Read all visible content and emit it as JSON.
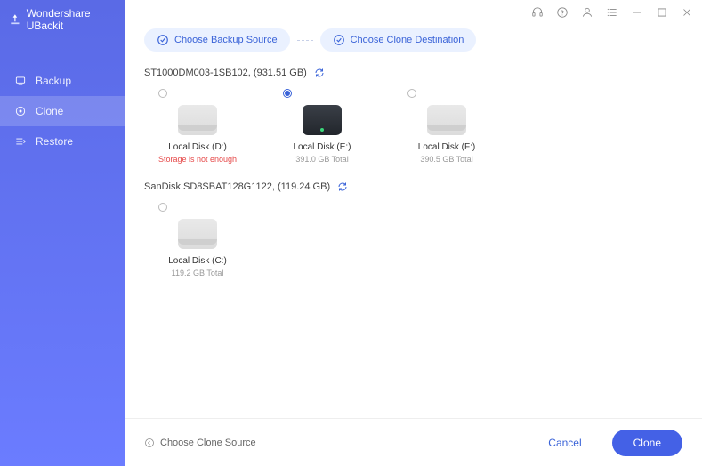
{
  "app_name": "Wondershare UBackit",
  "sidebar": {
    "items": [
      {
        "label": "Backup"
      },
      {
        "label": "Clone"
      },
      {
        "label": "Restore"
      }
    ]
  },
  "steps": {
    "source": "Choose Backup Source",
    "destination": "Choose Clone Destination"
  },
  "groups": [
    {
      "title": "ST1000DM003-1SB102, (931.51 GB)",
      "disks": [
        {
          "name": "Local Disk (D:)",
          "sub": "Storage is not enough",
          "sub_error": true,
          "style": "gray",
          "selected": false
        },
        {
          "name": "Local Disk (E:)",
          "sub": "391.0 GB Total",
          "sub_error": false,
          "style": "dark",
          "selected": true
        },
        {
          "name": "Local Disk (F:)",
          "sub": "390.5 GB Total",
          "sub_error": false,
          "style": "gray",
          "selected": false
        }
      ]
    },
    {
      "title": "SanDisk SD8SBAT128G1122, (119.24 GB)",
      "disks": [
        {
          "name": "Local Disk (C:)",
          "sub": "119.2 GB Total",
          "sub_error": false,
          "style": "gray",
          "selected": false
        }
      ]
    }
  ],
  "footer": {
    "back_label": "Choose Clone Source",
    "cancel": "Cancel",
    "clone": "Clone"
  }
}
